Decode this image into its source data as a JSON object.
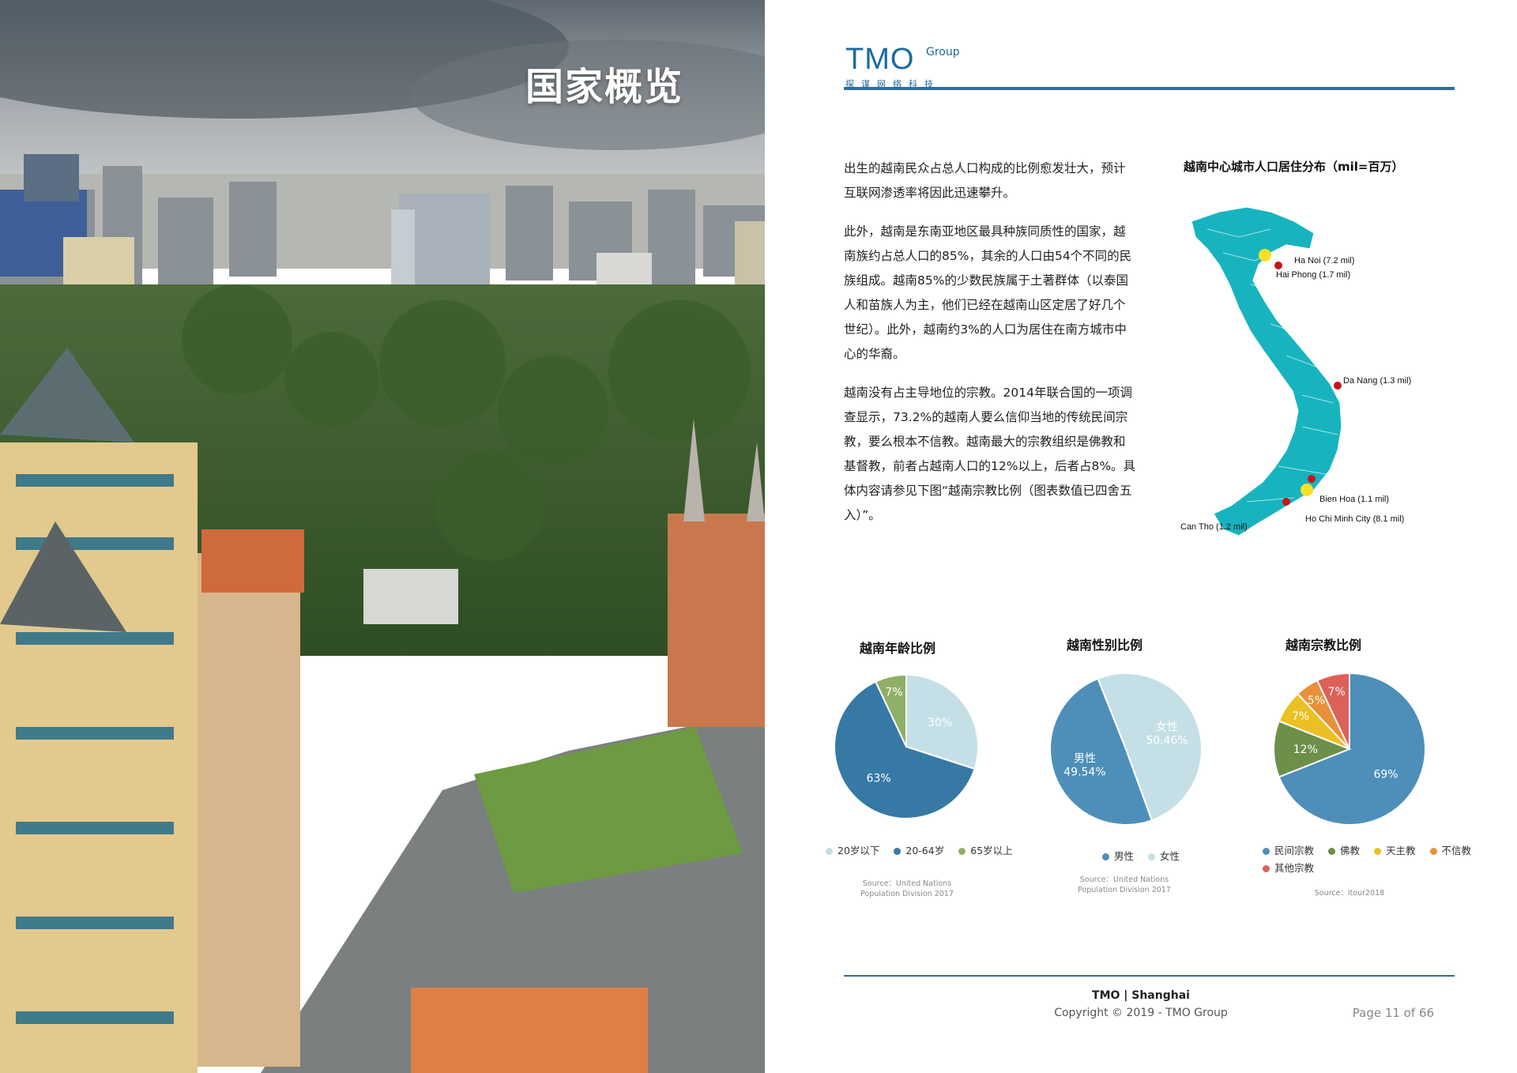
{
  "left_page": {
    "title": "国家概览"
  },
  "header": {
    "logo_text": "TMO",
    "logo_group": "Group",
    "logo_sub": "探谋网络科技"
  },
  "body": {
    "paragraphs": [
      "出生的越南民众占总人口构成的比例愈发壮大，预计互联网渗透率将因此迅速攀升。",
      "此外，越南是东南亚地区最具种族同质性的国家，越南族约占总人口的85%，其余的人口由54个不同的民族组成。越南85%的少数民族属于土著群体（以泰国人和苗族人为主，他们已经在越南山区定居了好几个世纪）。此外，越南约3%的人口为居住在南方城市中心的华裔。",
      "越南没有占主导地位的宗教。2014年联合国的一项调查显示，73.2%的越南人要么信仰当地的传统民间宗教，要么根本不信教。越南最大的宗教组织是佛教和基督教，前者占越南人口的12%以上，后者占8%。具体内容请参见下图“越南宗教比例（图表数值已四舍五入）”。"
    ]
  },
  "map": {
    "title": "越南中心城市人口居住分布（mil=百万）",
    "land_color": "#17b4bf",
    "cities": [
      {
        "label": "Ha Noi (7.2 mil)",
        "marker": "yellow"
      },
      {
        "label": "Hai Phong (1.7 mil)",
        "marker": "red"
      },
      {
        "label": "Da Nang (1.3 mil)",
        "marker": "red"
      },
      {
        "label": "Bien Hoa (1.1 mil)",
        "marker": "red"
      },
      {
        "label": "Ho Chi Minh City (8.1 mil)",
        "marker": "yellow"
      },
      {
        "label": "Can Tho (1.2 mil)",
        "marker": "red"
      }
    ]
  },
  "chart_data": [
    {
      "type": "pie",
      "title": "越南年龄比例",
      "categories": [
        "20岁以下",
        "20-64岁",
        "65岁以上"
      ],
      "values": [
        30,
        63,
        7
      ],
      "value_labels": [
        "30%",
        "63%",
        "7%"
      ],
      "colors": [
        "#c5dfe6",
        "#3679a5",
        "#8fae68"
      ],
      "source": [
        "Source：United Nations",
        "Population Division 2017"
      ]
    },
    {
      "type": "pie",
      "title": "越南性别比例",
      "categories": [
        "男性",
        "女性"
      ],
      "values": [
        49.54,
        50.46
      ],
      "value_labels": [
        "男性\n49.54%",
        "女性\n50.46%"
      ],
      "colors": [
        "#4d8fb8",
        "#c5dfe6"
      ],
      "source": [
        "Source：United Nations",
        "Population Division 2017"
      ]
    },
    {
      "type": "pie",
      "title": "越南宗教比例",
      "categories": [
        "民间宗教",
        "佛教",
        "天主教",
        "不信教",
        "其他宗教"
      ],
      "values": [
        69,
        12,
        7,
        5,
        7
      ],
      "value_labels": [
        "69%",
        "12%",
        "7%",
        "5%",
        "7%"
      ],
      "colors": [
        "#4d8fb8",
        "#6e8f4a",
        "#ecc024",
        "#e8913a",
        "#dc6158"
      ],
      "source": [
        "Source：itour2018"
      ]
    }
  ],
  "footer": {
    "title": "TMO | Shanghai",
    "copyright": "Copyright © 2019 - TMO Group",
    "page": "Page 11 of 66"
  }
}
